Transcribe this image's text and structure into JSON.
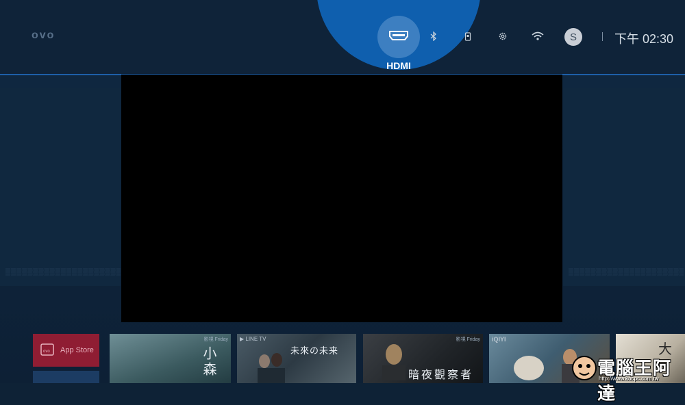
{
  "header": {
    "logo": "ovo",
    "active_input": {
      "label": "HDMI",
      "icon": "hdmi-icon"
    },
    "status_icons": [
      "bluetooth-icon",
      "usb-storage-icon",
      "settings-icon",
      "wifi-icon"
    ],
    "avatar_initial": "S",
    "clock": "下午 02:30"
  },
  "tiles": [
    {
      "label": "App Store",
      "icon": "shopping-bag-icon"
    },
    {
      "tag": "影視 Friday",
      "title": "小森"
    },
    {
      "brand": "▶ LINE TV",
      "title": "未來の未来"
    },
    {
      "tag": "影視 Friday",
      "title": "暗夜觀察者"
    },
    {
      "brand": "iQIYI",
      "title": ""
    },
    {
      "title": "大"
    }
  ],
  "watermark": {
    "text": "電腦王阿達",
    "url": "http://www.kocpc.com.tw"
  },
  "colors": {
    "accent": "#0f5fae",
    "background": "#0e2236",
    "hdmi_circle": "#3d7fc1"
  }
}
